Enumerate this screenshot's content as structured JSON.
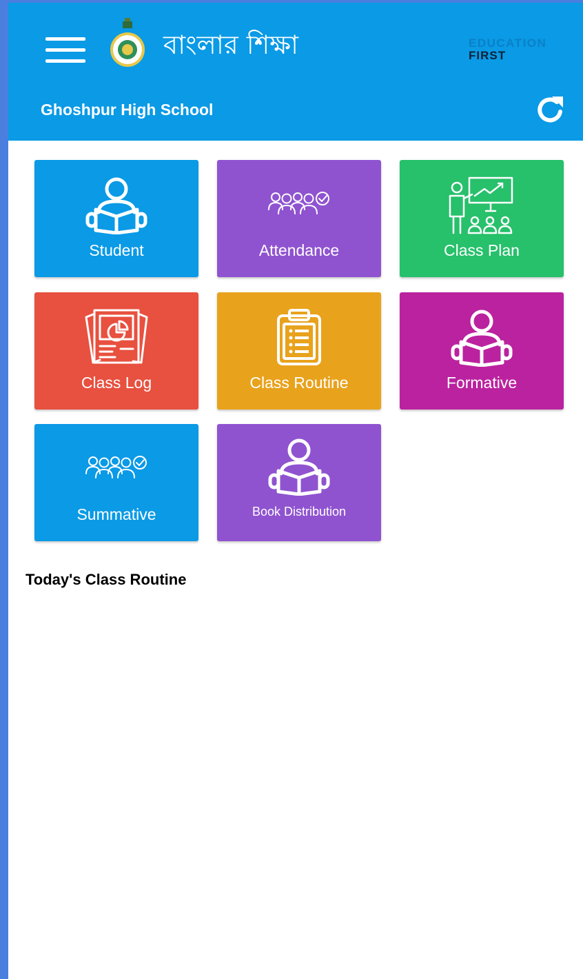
{
  "header": {
    "brand_title": "বাংলার শিক্ষা",
    "tagline_line1": "EDUCATION",
    "tagline_line2": "FIRST",
    "school_name": "Ghoshpur High School",
    "bar_color": "#0a9ae6"
  },
  "icons": {
    "menu": "hamburger-menu-icon",
    "logo": "government-emblem-logo",
    "refresh": "refresh-icon"
  },
  "tiles": [
    {
      "label": "Student",
      "color": "#0a9ae6",
      "icon": "student-reading-icon"
    },
    {
      "label": "Attendance",
      "color": "#8f53d0",
      "icon": "group-check-icon"
    },
    {
      "label": "Class Plan",
      "color": "#27c06b",
      "icon": "teacher-presentation-icon"
    },
    {
      "label": "Class Log",
      "color": "#e8503f",
      "icon": "report-document-icon"
    },
    {
      "label": "Class Routine",
      "color": "#e8a21c",
      "icon": "clipboard-list-icon"
    },
    {
      "label": "Formative",
      "color": "#bb229f",
      "icon": "student-reading-icon"
    },
    {
      "label": "Summative",
      "color": "#0a9ae6",
      "icon": "group-check-icon"
    },
    {
      "label": "Book Distribution",
      "color": "#8f53d0",
      "icon": "student-reading-icon"
    }
  ],
  "routine": {
    "title": "Today's Class Routine"
  }
}
